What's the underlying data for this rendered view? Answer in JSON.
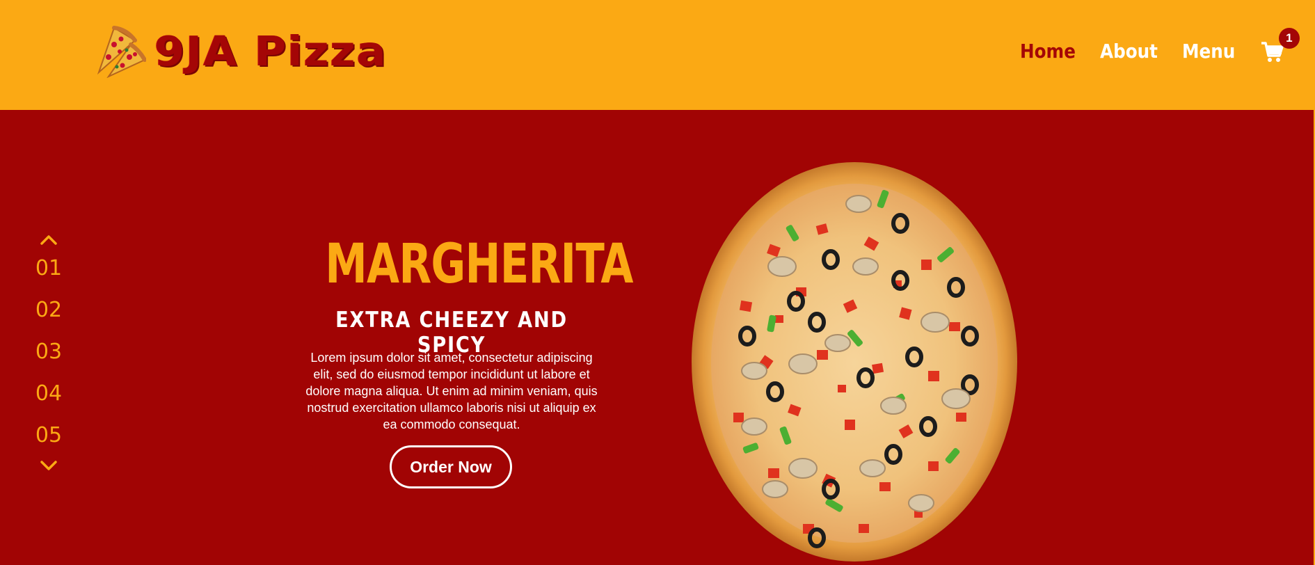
{
  "brand": {
    "name": "9JA Pizza",
    "icon": "pizza-slice-icon",
    "colors": {
      "primary": "#fba914",
      "accent": "#a10404",
      "text_light": "#ffffff"
    }
  },
  "nav": {
    "items": [
      {
        "label": "Home",
        "active": true
      },
      {
        "label": "About",
        "active": false
      },
      {
        "label": "Menu",
        "active": false
      }
    ],
    "cart_icon": "cart-icon",
    "cart_count": "1"
  },
  "slider": {
    "up_icon": "chevron-up-icon",
    "down_icon": "chevron-down-icon",
    "items": [
      "01",
      "02",
      "03",
      "04",
      "05"
    ]
  },
  "hero": {
    "title": "MARGHERITA",
    "subtitle": "EXTRA CHEEZY AND SPICY",
    "description": "Lorem ipsum dolor sit amet, consectetur adipiscing elit, sed do eiusmod tempor incididunt ut labore et dolore magna aliqua. Ut enim ad minim veniam, quis nostrud exercitation ullamco laboris nisi ut aliquip ex ea commodo consequat.",
    "cta_label": "Order Now",
    "image": "pizza-image"
  }
}
